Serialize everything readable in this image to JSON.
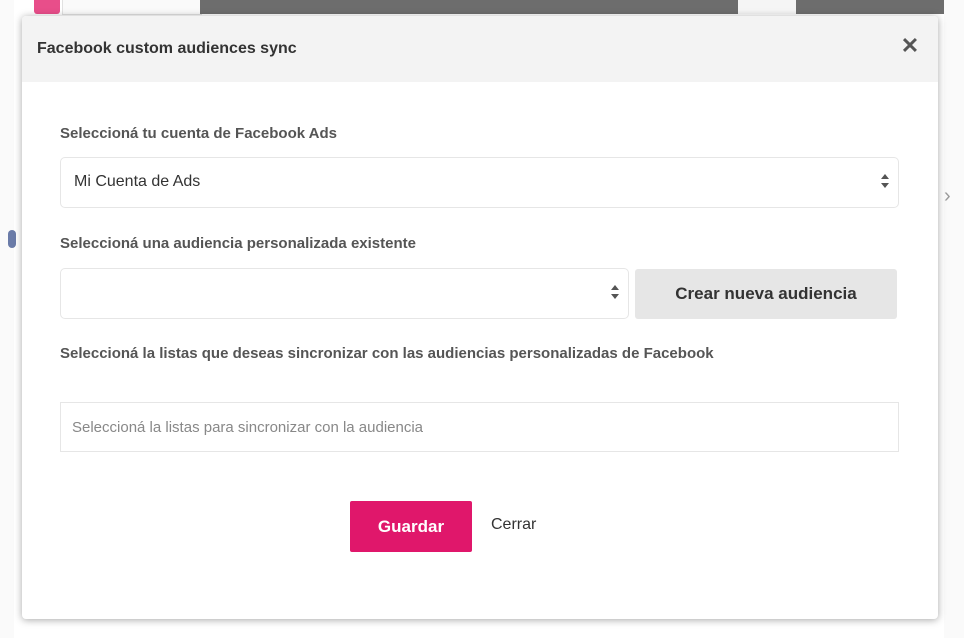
{
  "modal": {
    "title": "Facebook custom audiences sync",
    "close_icon": "close-icon",
    "account_label": "Seleccioná tu cuenta de Facebook Ads",
    "account_value": "Mi Cuenta de Ads",
    "audience_label": "Seleccioná una audiencia personalizada existente",
    "audience_value": "",
    "create_audience_button": "Crear nueva audiencia",
    "lists_label": "Seleccioná la listas que deseas sincronizar con las audiencias personalizadas de Facebook",
    "lists_placeholder": "Seleccioná la listas para sincronizar con la audiencia",
    "save_button": "Guardar",
    "cancel_link": "Cerrar"
  },
  "colors": {
    "accent": "#e0176b",
    "header_bg": "#f3f3f3",
    "button_gray": "#e6e6e6"
  }
}
